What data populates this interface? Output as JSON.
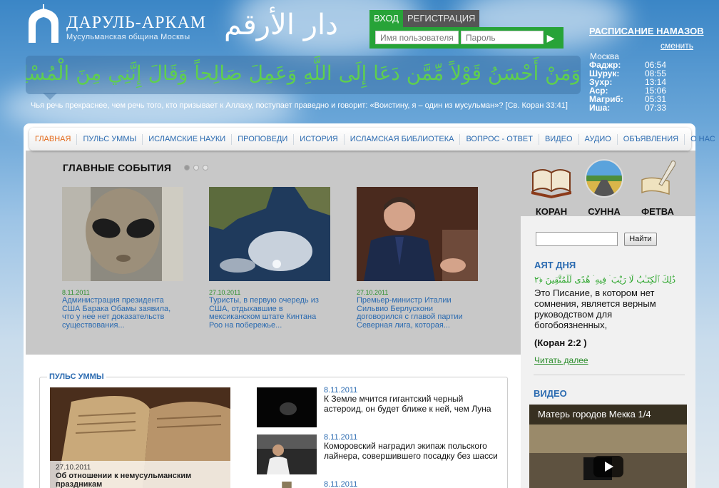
{
  "header": {
    "site_title": "ДАРУЛЬ-АРКАМ",
    "site_subtitle": "Мусульманская община Москвы",
    "arabic_name": "دار الأرقم",
    "banner_arabic": "وَمَنْ أَحْسَنُ قَوْلاً مِّمَّن دَعَا إِلَى اللَّهِ وَعَمِلَ صَالِحاً وَقَالَ إِنَّنِي مِنَ الْمُسْلِمِينَ",
    "banner_translation": "Чья речь прекраснее, чем речь того, кто призывает к Аллаху, поступает праведно и говорит: «Воистину, я – один из мусульман»?  [Св. Коран 33:41]"
  },
  "login": {
    "tab_login": "ВХОД",
    "tab_register": "РЕГИСТРАЦИЯ",
    "username_placeholder": "Имя пользователя",
    "password_placeholder": "Пароль",
    "submit_icon": "arrow-right-icon"
  },
  "prayer": {
    "title": "РАСПИСАНИЕ НАМАЗОВ",
    "change_link": "сменить",
    "city": "Москва",
    "times": [
      {
        "name": "Фаджр:",
        "time": "06:54"
      },
      {
        "name": "Шурук:",
        "time": "08:55"
      },
      {
        "name": "Зухр:",
        "time": "13:14"
      },
      {
        "name": "Аср:",
        "time": "15:06"
      },
      {
        "name": "Магриб:",
        "time": "05:31"
      },
      {
        "name": "Иша:",
        "time": "07:33"
      }
    ]
  },
  "nav": {
    "items": [
      "ГЛАВНАЯ",
      "ПУЛЬС УММЫ",
      "ИСЛАМСКИЕ НАУКИ",
      "ПРОПОВЕДИ",
      "ИСТОРИЯ",
      "ИСЛАМСКАЯ БИБЛИОТЕКА",
      "ВОПРОС - ОТВЕТ",
      "ВИДЕО",
      "АУДИО",
      "ОБЪЯВЛЕНИЯ",
      "О НАС"
    ],
    "active_index": 0
  },
  "events": {
    "title": "ГЛАВНЫЕ СОБЫТИЯ",
    "items": [
      {
        "date": "8.11.2011",
        "text": "Администрация президента США Барака Обамы заявила, что у нее нет доказательств существования..."
      },
      {
        "date": "27.10.2011",
        "text": "Туристы, в первую очередь из США, отдыхавшие в мексиканском штате Кинтана Роо на побережье..."
      },
      {
        "date": "27.10.2011",
        "text": "Премьер-министр Италии Сильвио Берлускони договорился с главой партии Северная лига, которая..."
      }
    ]
  },
  "quick_links": [
    {
      "label": "КОРАН",
      "icon": "quran-book-icon"
    },
    {
      "label": "СУННА",
      "icon": "road-icon"
    },
    {
      "label": "ФЕТВА",
      "icon": "scroll-quill-icon"
    }
  ],
  "search": {
    "button": "Найти"
  },
  "ayah": {
    "title": "АЯТ ДНЯ",
    "arabic": "ذَٰلِكَ ٱلْكِتَـٰبُ لَا رَيْبَ ۛ فِيهِ ۛ هُدًى لِّلْمُتَّقِينَ ﴿٢",
    "text": "Это Писание, в котором нет сомнения, является верным руководством для богобоязненных,",
    "ref": "(Коран 2:2 )",
    "more": "Читать далее"
  },
  "video": {
    "title": "ВИДЕО",
    "caption": "Матерь городов Мекка 1/4"
  },
  "pulse": {
    "title": "ПУЛЬС УММЫ",
    "main_date": "27.10.2011",
    "main_text": "Об отношении к немусульманским праздникам",
    "news": [
      {
        "date": "8.11.2011",
        "text": "К Земле мчится гигантский черный астероид, он будет ближе к ней, чем Луна"
      },
      {
        "date": "8.11.2011",
        "text": "Коморовский наградил экипаж польского лайнера, совершившего посадку без шасси"
      },
      {
        "date": "8.11.2011",
        "text": ""
      }
    ]
  },
  "colors": {
    "link_blue": "#2a6ab0",
    "active_orange": "#e46a1b",
    "green": "#27a338",
    "gray_panel": "#c8c8c8"
  }
}
